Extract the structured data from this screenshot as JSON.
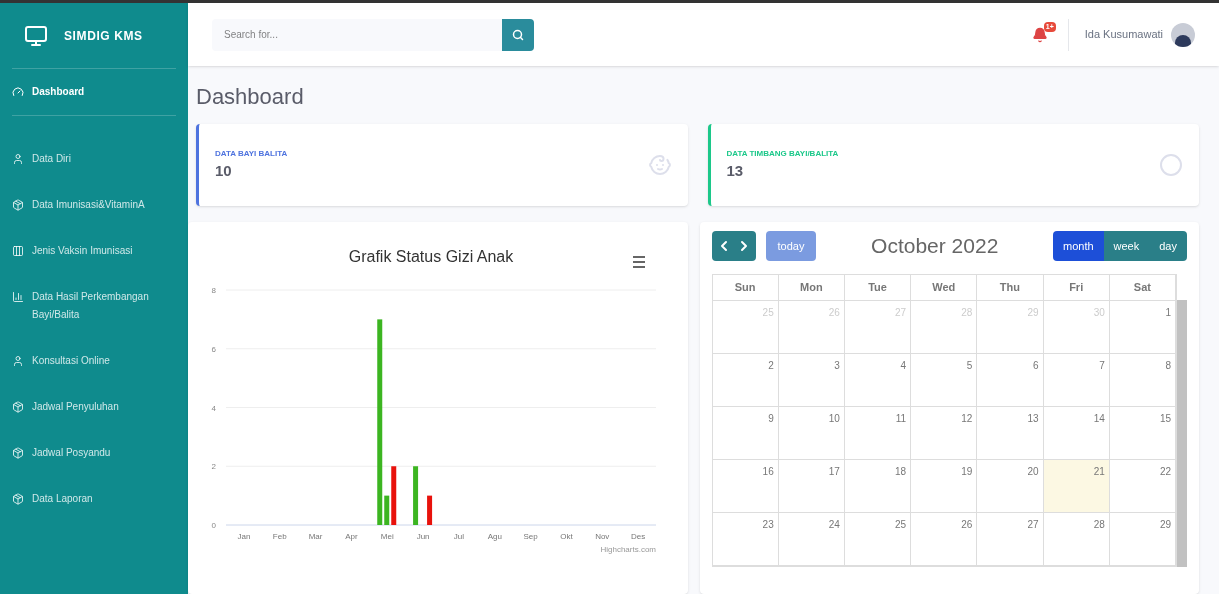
{
  "brand": {
    "name": "SIMDIG KMS"
  },
  "sidebar": {
    "items": [
      {
        "label": "Dashboard",
        "selected": true
      },
      {
        "label": "Data Diri",
        "selected": false
      },
      {
        "label": "Data Imunisasi&VitaminA",
        "selected": false
      },
      {
        "label": "Jenis Vaksin Imunisasi",
        "selected": false
      },
      {
        "label": "Data Hasil Perkembangan Bayi/Balita",
        "selected": false
      },
      {
        "label": "Konsultasi Online",
        "selected": false
      },
      {
        "label": "Jadwal Penyuluhan",
        "selected": false
      },
      {
        "label": "Jadwal Posyandu",
        "selected": false
      },
      {
        "label": "Data Laporan",
        "selected": false
      }
    ]
  },
  "topbar": {
    "search": {
      "placeholder": "Search for..."
    },
    "alerts_badge": "1+",
    "user_name": "Ida Kusumawati"
  },
  "page_title": "Dashboard",
  "stats": [
    {
      "label": "DATA BAYI BALITA",
      "value": "10",
      "color": "#4e73df"
    },
    {
      "label": "DATA TIMBANG BAYI/BALITA",
      "value": "13",
      "color": "#1cc88a"
    }
  ],
  "chart": {
    "chart_data": {
      "type": "bar",
      "title": "Grafik Status Gizi Anak",
      "categories": [
        "Jan",
        "Feb",
        "Mar",
        "Apr",
        "Mei",
        "Jun",
        "Jul",
        "Agu",
        "Sep",
        "Okt",
        "Nov",
        "Des"
      ],
      "series": [
        {
          "color": "#3cb521",
          "values": [
            0,
            0,
            0,
            0,
            7,
            2,
            0,
            0,
            0,
            0,
            0,
            0
          ]
        },
        {
          "color": "#3cb521",
          "values": [
            0,
            0,
            0,
            0,
            1,
            0,
            0,
            0,
            0,
            0,
            0,
            0
          ]
        },
        {
          "color": "#e8120c",
          "values": [
            0,
            0,
            0,
            0,
            2,
            1,
            0,
            0,
            0,
            0,
            0,
            0
          ]
        }
      ],
      "ylim": [
        0,
        8
      ],
      "yticks": [
        0,
        2,
        4,
        6,
        8
      ],
      "grid": true
    },
    "credit": "Highcharts.com"
  },
  "calendar": {
    "title": "October 2022",
    "today_label": "today",
    "views": [
      {
        "label": "month",
        "selected": true
      },
      {
        "label": "week",
        "selected": false
      },
      {
        "label": "day",
        "selected": false
      }
    ],
    "weekdays": [
      "Sun",
      "Mon",
      "Tue",
      "Wed",
      "Thu",
      "Fri",
      "Sat"
    ],
    "weeks": [
      [
        {
          "day": "25",
          "other_month": true,
          "today": false
        },
        {
          "day": "26",
          "other_month": true,
          "today": false
        },
        {
          "day": "27",
          "other_month": true,
          "today": false
        },
        {
          "day": "28",
          "other_month": true,
          "today": false
        },
        {
          "day": "29",
          "other_month": true,
          "today": false
        },
        {
          "day": "30",
          "other_month": true,
          "today": false
        },
        {
          "day": "1",
          "other_month": false,
          "today": false
        }
      ],
      [
        {
          "day": "2",
          "other_month": false,
          "today": false
        },
        {
          "day": "3",
          "other_month": false,
          "today": false
        },
        {
          "day": "4",
          "other_month": false,
          "today": false
        },
        {
          "day": "5",
          "other_month": false,
          "today": false
        },
        {
          "day": "6",
          "other_month": false,
          "today": false
        },
        {
          "day": "7",
          "other_month": false,
          "today": false
        },
        {
          "day": "8",
          "other_month": false,
          "today": false
        }
      ],
      [
        {
          "day": "9",
          "other_month": false,
          "today": false
        },
        {
          "day": "10",
          "other_month": false,
          "today": false
        },
        {
          "day": "11",
          "other_month": false,
          "today": false
        },
        {
          "day": "12",
          "other_month": false,
          "today": false
        },
        {
          "day": "13",
          "other_month": false,
          "today": false
        },
        {
          "day": "14",
          "other_month": false,
          "today": false
        },
        {
          "day": "15",
          "other_month": false,
          "today": false
        }
      ],
      [
        {
          "day": "16",
          "other_month": false,
          "today": false
        },
        {
          "day": "17",
          "other_month": false,
          "today": false
        },
        {
          "day": "18",
          "other_month": false,
          "today": false
        },
        {
          "day": "19",
          "other_month": false,
          "today": false
        },
        {
          "day": "20",
          "other_month": false,
          "today": false
        },
        {
          "day": "21",
          "other_month": false,
          "today": true
        },
        {
          "day": "22",
          "other_month": false,
          "today": false
        }
      ],
      [
        {
          "day": "23",
          "other_month": false,
          "today": false
        },
        {
          "day": "24",
          "other_month": false,
          "today": false
        },
        {
          "day": "25",
          "other_month": false,
          "today": false
        },
        {
          "day": "26",
          "other_month": false,
          "today": false
        },
        {
          "day": "27",
          "other_month": false,
          "today": false
        },
        {
          "day": "28",
          "other_month": false,
          "today": false
        },
        {
          "day": "29",
          "other_month": false,
          "today": false
        }
      ]
    ]
  }
}
